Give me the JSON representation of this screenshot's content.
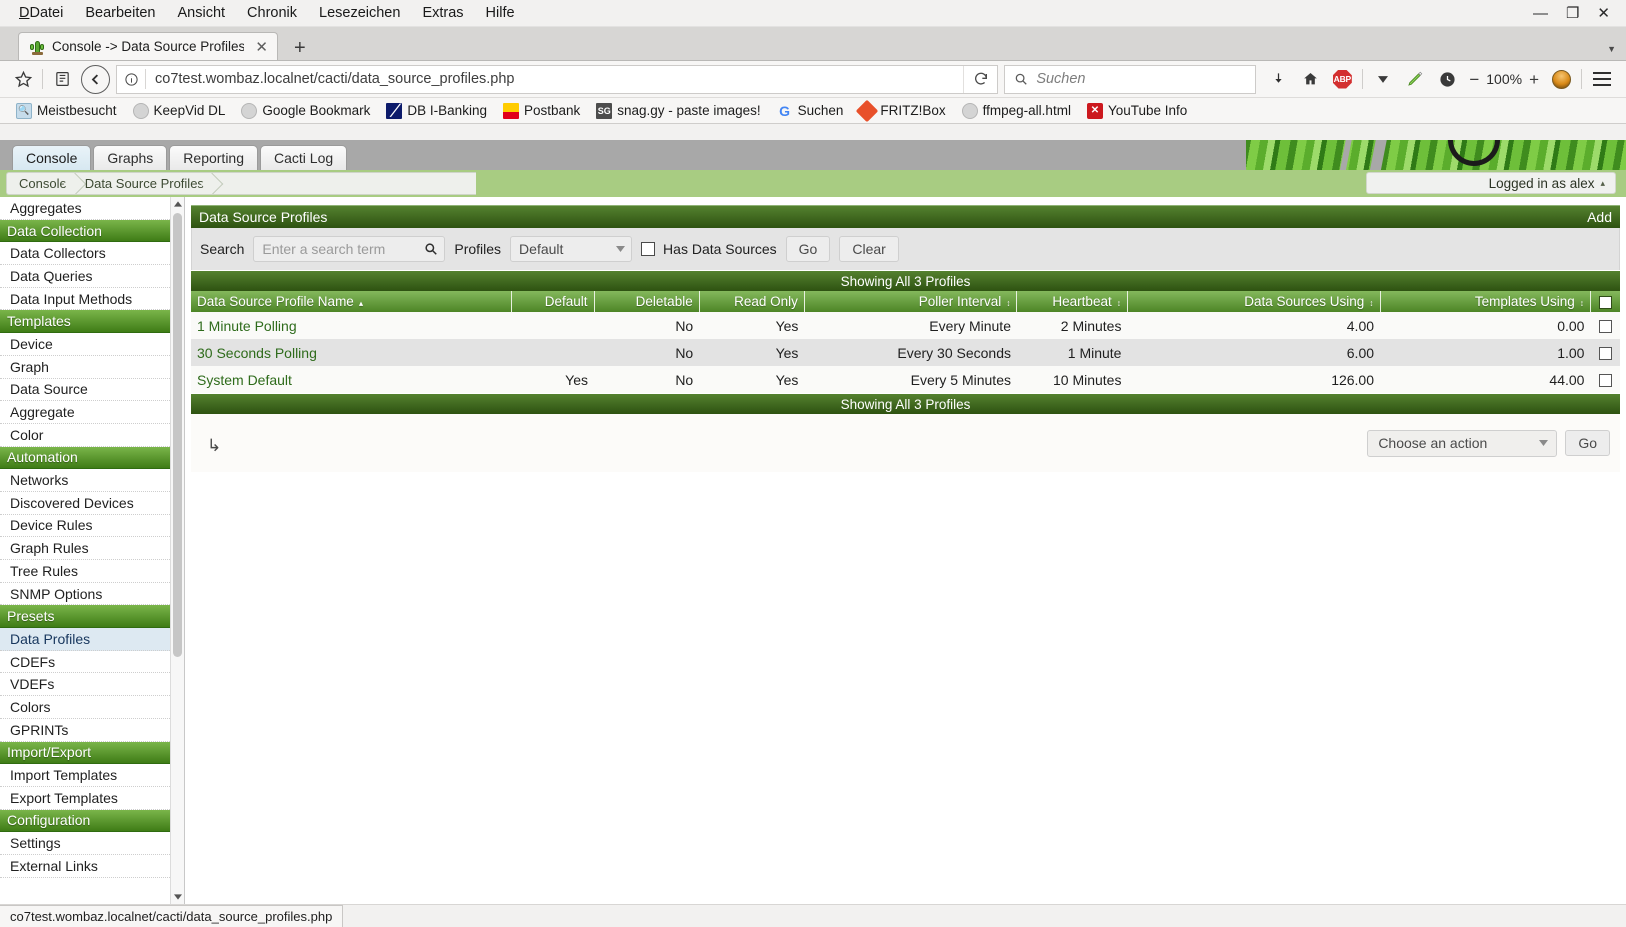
{
  "browser": {
    "menus": [
      "Datei",
      "Bearbeiten",
      "Ansicht",
      "Chronik",
      "Lesezeichen",
      "Extras",
      "Hilfe"
    ],
    "window_controls": {
      "minimize": "—",
      "maximize": "❐",
      "close": "✕"
    },
    "tab": {
      "title": "Console -> Data Source Profiles",
      "favicon": "cactus-icon",
      "close": "✕"
    },
    "new_tab": "+",
    "tab_list_caret": "▼",
    "url": "co7test.wombaz.localnet/cacti/data_source_profiles.php",
    "search": {
      "placeholder": "Suchen",
      "icon": "search-icon"
    },
    "zoom": {
      "minus": "−",
      "level": "100%",
      "plus": "+"
    },
    "toolbar_icons": [
      "download-icon",
      "home-icon",
      "abp-icon",
      "chevron-down-icon",
      "bookmark-pencil-icon",
      "session-restore-icon",
      "avatar-icon",
      "menu-icon"
    ],
    "abp_label": "ABP",
    "bookmarks": [
      {
        "label": "Meistbesucht",
        "icon": "most-visited-icon"
      },
      {
        "label": "KeepVid DL",
        "icon": "globe-icon"
      },
      {
        "label": "Google Bookmark",
        "icon": "globe-icon"
      },
      {
        "label": "DB I-Banking",
        "icon": "deutsche-bank-icon",
        "glyph": "╱"
      },
      {
        "label": "Postbank",
        "icon": "postbank-icon"
      },
      {
        "label": "snag.gy - paste images!",
        "icon": "snaggy-icon",
        "glyph": "SG"
      },
      {
        "label": "Suchen",
        "icon": "google-icon",
        "glyph": "G"
      },
      {
        "label": "FRITZ!Box",
        "icon": "fritzbox-icon"
      },
      {
        "label": "ffmpeg-all.html",
        "icon": "globe-icon"
      },
      {
        "label": "YouTube Info",
        "icon": "youtube-icon",
        "glyph": "✕"
      }
    ],
    "status_tip": "co7test.wombaz.localnet/cacti/data_source_profiles.php"
  },
  "cacti": {
    "tabs": [
      {
        "label": "Console",
        "active": true
      },
      {
        "label": "Graphs",
        "active": false
      },
      {
        "label": "Reporting",
        "active": false
      },
      {
        "label": "Cacti Log",
        "active": false
      }
    ],
    "breadcrumb": [
      "Console",
      "Data Source Profiles"
    ],
    "login_status": "Logged in as alex",
    "login_caret": "▴",
    "sidebar": [
      {
        "label": "Aggregates",
        "type": "item"
      },
      {
        "label": "Data Collection",
        "type": "section"
      },
      {
        "label": "Data Collectors",
        "type": "item"
      },
      {
        "label": "Data Queries",
        "type": "item"
      },
      {
        "label": "Data Input Methods",
        "type": "item"
      },
      {
        "label": "Templates",
        "type": "section"
      },
      {
        "label": "Device",
        "type": "item"
      },
      {
        "label": "Graph",
        "type": "item"
      },
      {
        "label": "Data Source",
        "type": "item"
      },
      {
        "label": "Aggregate",
        "type": "item"
      },
      {
        "label": "Color",
        "type": "item"
      },
      {
        "label": "Automation",
        "type": "section"
      },
      {
        "label": "Networks",
        "type": "item"
      },
      {
        "label": "Discovered Devices",
        "type": "item"
      },
      {
        "label": "Device Rules",
        "type": "item"
      },
      {
        "label": "Graph Rules",
        "type": "item"
      },
      {
        "label": "Tree Rules",
        "type": "item"
      },
      {
        "label": "SNMP Options",
        "type": "item"
      },
      {
        "label": "Presets",
        "type": "section"
      },
      {
        "label": "Data Profiles",
        "type": "item",
        "selected": true
      },
      {
        "label": "CDEFs",
        "type": "item"
      },
      {
        "label": "VDEFs",
        "type": "item"
      },
      {
        "label": "Colors",
        "type": "item"
      },
      {
        "label": "GPRINTs",
        "type": "item"
      },
      {
        "label": "Import/Export",
        "type": "section"
      },
      {
        "label": "Import Templates",
        "type": "item"
      },
      {
        "label": "Export Templates",
        "type": "item"
      },
      {
        "label": "Configuration",
        "type": "section"
      },
      {
        "label": "Settings",
        "type": "item"
      },
      {
        "label": "External Links",
        "type": "item"
      }
    ],
    "panel": {
      "title": "Data Source Profiles",
      "add_label": "Add",
      "filter": {
        "search_label": "Search",
        "search_placeholder": "Enter a search term",
        "search_value": "",
        "search_icon": "search-icon",
        "profiles_label": "Profiles",
        "profiles_value": "Default",
        "profiles_options": [
          "Default"
        ],
        "has_data_sources_label": "Has Data Sources",
        "has_data_sources_checked": false,
        "go_label": "Go",
        "clear_label": "Clear"
      },
      "showing_top": "Showing All 3 Profiles",
      "showing_bottom": "Showing All 3 Profiles",
      "columns": [
        {
          "label": "Data Source Profile Name",
          "sort": "asc",
          "align": "left"
        },
        {
          "label": "Default",
          "sort": "none",
          "align": "right"
        },
        {
          "label": "Deletable",
          "sort": "none",
          "align": "right"
        },
        {
          "label": "Read Only",
          "sort": "none",
          "align": "right"
        },
        {
          "label": "Poller Interval",
          "sort": "both",
          "align": "right"
        },
        {
          "label": "Heartbeat",
          "sort": "both",
          "align": "right"
        },
        {
          "label": "Data Sources Using",
          "sort": "both",
          "align": "right"
        },
        {
          "label": "Templates Using",
          "sort": "both",
          "align": "right"
        }
      ],
      "select_all_checked": false,
      "rows": [
        {
          "name": "1 Minute Polling",
          "default": "",
          "deletable": "No",
          "read_only": "Yes",
          "poller_interval": "Every Minute",
          "heartbeat": "2 Minutes",
          "data_sources_using": "4.00",
          "templates_using": "0.00",
          "checked": false
        },
        {
          "name": "30 Seconds Polling",
          "default": "",
          "deletable": "No",
          "read_only": "Yes",
          "poller_interval": "Every 30 Seconds",
          "heartbeat": "1 Minute",
          "data_sources_using": "6.00",
          "templates_using": "1.00",
          "checked": false
        },
        {
          "name": "System Default",
          "default": "Yes",
          "deletable": "No",
          "read_only": "Yes",
          "poller_interval": "Every 5 Minutes",
          "heartbeat": "10 Minutes",
          "data_sources_using": "126.00",
          "templates_using": "44.00",
          "checked": false
        }
      ],
      "action": {
        "select_value": "Choose an action",
        "go_label": "Go",
        "arrow_glyph": "↳"
      }
    },
    "colors": {
      "header_green_dark": "#2e5211",
      "header_green_light": "#84b85c",
      "section_green": "#3f7c16",
      "crumb_green": "#a8cc82",
      "link_green": "#2e6b1b",
      "selected_blue": "#dde9f2",
      "row_alt": "#e3e3e3"
    }
  }
}
